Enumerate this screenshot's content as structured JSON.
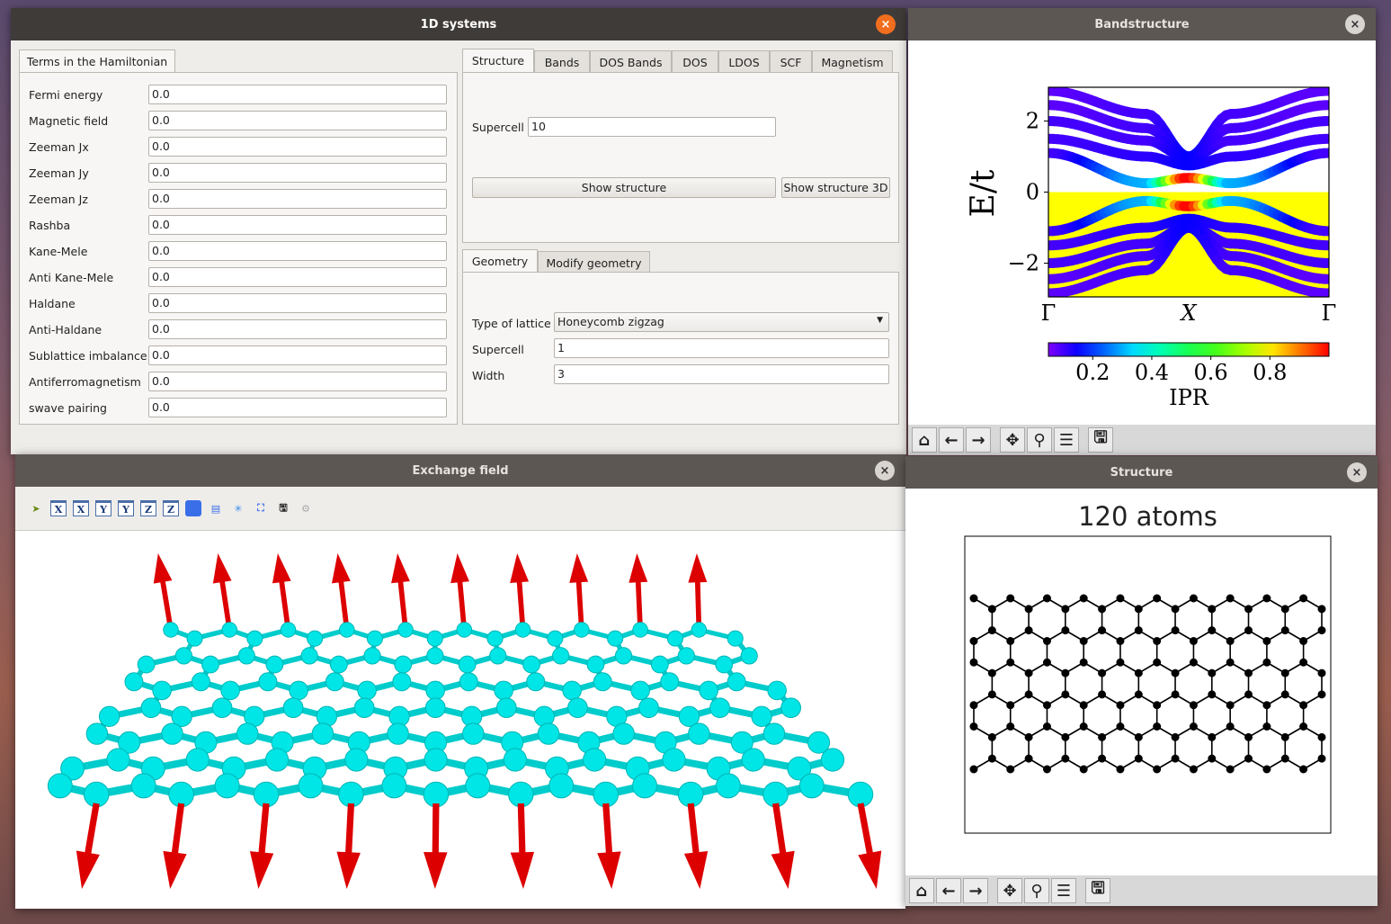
{
  "main_window": {
    "title": "1D systems",
    "close": "×",
    "hamiltonian": {
      "tab": "Terms in the Hamiltonian",
      "fields": [
        {
          "label": "Fermi energy",
          "value": "0.0"
        },
        {
          "label": "Magnetic field",
          "value": "0.0"
        },
        {
          "label": "Zeeman Jx",
          "value": "0.0"
        },
        {
          "label": "Zeeman Jy",
          "value": "0.0"
        },
        {
          "label": "Zeeman Jz",
          "value": "0.0"
        },
        {
          "label": "Rashba",
          "value": "0.0"
        },
        {
          "label": "Kane-Mele",
          "value": "0.0"
        },
        {
          "label": "Anti Kane-Mele",
          "value": "0.0"
        },
        {
          "label": "Haldane",
          "value": "0.0"
        },
        {
          "label": "Anti-Haldane",
          "value": "0.0"
        },
        {
          "label": "Sublattice imbalance",
          "value": "0.0"
        },
        {
          "label": "Antiferromagnetism",
          "value": "0.0"
        },
        {
          "label": "swave pairing",
          "value": "0.0"
        }
      ]
    },
    "tabs": [
      "Structure",
      "Bands",
      "DOS Bands",
      "DOS",
      "LDOS",
      "SCF",
      "Magnetism"
    ],
    "structure": {
      "supercell_label": "Supercell",
      "supercell_value": "10",
      "show_structure": "Show structure",
      "show_structure_3d": "Show structure 3D"
    },
    "geometry_tabs": [
      "Geometry",
      "Modify geometry"
    ],
    "geometry": {
      "lattice_label": "Type of lattice",
      "lattice_value": "Honeycomb zigzag",
      "supercell_label": "Supercell",
      "supercell_value": "1",
      "width_label": "Width",
      "width_value": "3"
    }
  },
  "band_window": {
    "title": "Bandstructure",
    "close": "×"
  },
  "exchange_window": {
    "title": "Exchange field",
    "close": "×",
    "toolbar_axes": [
      "X",
      "X",
      "Y",
      "Y",
      "Z",
      "Z"
    ]
  },
  "structure_window": {
    "title": "Structure",
    "close": "×",
    "plot_title": "120 atoms"
  },
  "colors": {
    "fill": "#ffff00",
    "atom3d": "#00e5e5",
    "arrow": "#dd0000",
    "accent": "#f06e1e"
  },
  "chart_data": {
    "type": "line",
    "ylabel": "E/t",
    "ylim": [
      -2.95,
      2.95
    ],
    "yticks": [
      -2,
      0,
      2
    ],
    "ytick_labels": [
      "−2",
      "0",
      "2"
    ],
    "xticks": [
      "Γ",
      "X",
      "Γ"
    ],
    "shaded_region": "E < 0",
    "colorbar": {
      "label": "IPR",
      "ticks": [
        "0.2",
        "0.4",
        "0.6",
        "0.8"
      ],
      "range": [
        0.05,
        1.0
      ],
      "colormap": "rainbow"
    },
    "k_samples": [
      0,
      0.35,
      0.5
    ],
    "bands": [
      {
        "E": [
          2.85,
          2.2,
          1.0
        ],
        "ipr": [
          0.08,
          0.1,
          0.15
        ]
      },
      {
        "E": [
          2.45,
          1.8,
          1.0
        ],
        "ipr": [
          0.08,
          0.1,
          0.15
        ]
      },
      {
        "E": [
          2.0,
          1.45,
          0.95
        ],
        "ipr": [
          0.1,
          0.1,
          0.15
        ]
      },
      {
        "E": [
          1.5,
          1.0,
          0.75
        ],
        "ipr": [
          0.1,
          0.12,
          0.15
        ]
      },
      {
        "E": [
          1.1,
          0.25,
          0.4
        ],
        "ipr": [
          0.1,
          0.3,
          1.0
        ]
      },
      {
        "E": [
          -1.1,
          -0.25,
          -0.4
        ],
        "ipr": [
          0.1,
          0.3,
          1.0
        ]
      },
      {
        "E": [
          -1.5,
          -1.0,
          -0.75
        ],
        "ipr": [
          0.1,
          0.12,
          0.15
        ]
      },
      {
        "E": [
          -2.0,
          -1.45,
          -0.95
        ],
        "ipr": [
          0.1,
          0.1,
          0.15
        ]
      },
      {
        "E": [
          -2.45,
          -1.8,
          -1.0
        ],
        "ipr": [
          0.08,
          0.1,
          0.15
        ]
      },
      {
        "E": [
          -2.85,
          -2.2,
          -1.0
        ],
        "ipr": [
          0.08,
          0.1,
          0.15
        ]
      }
    ]
  }
}
